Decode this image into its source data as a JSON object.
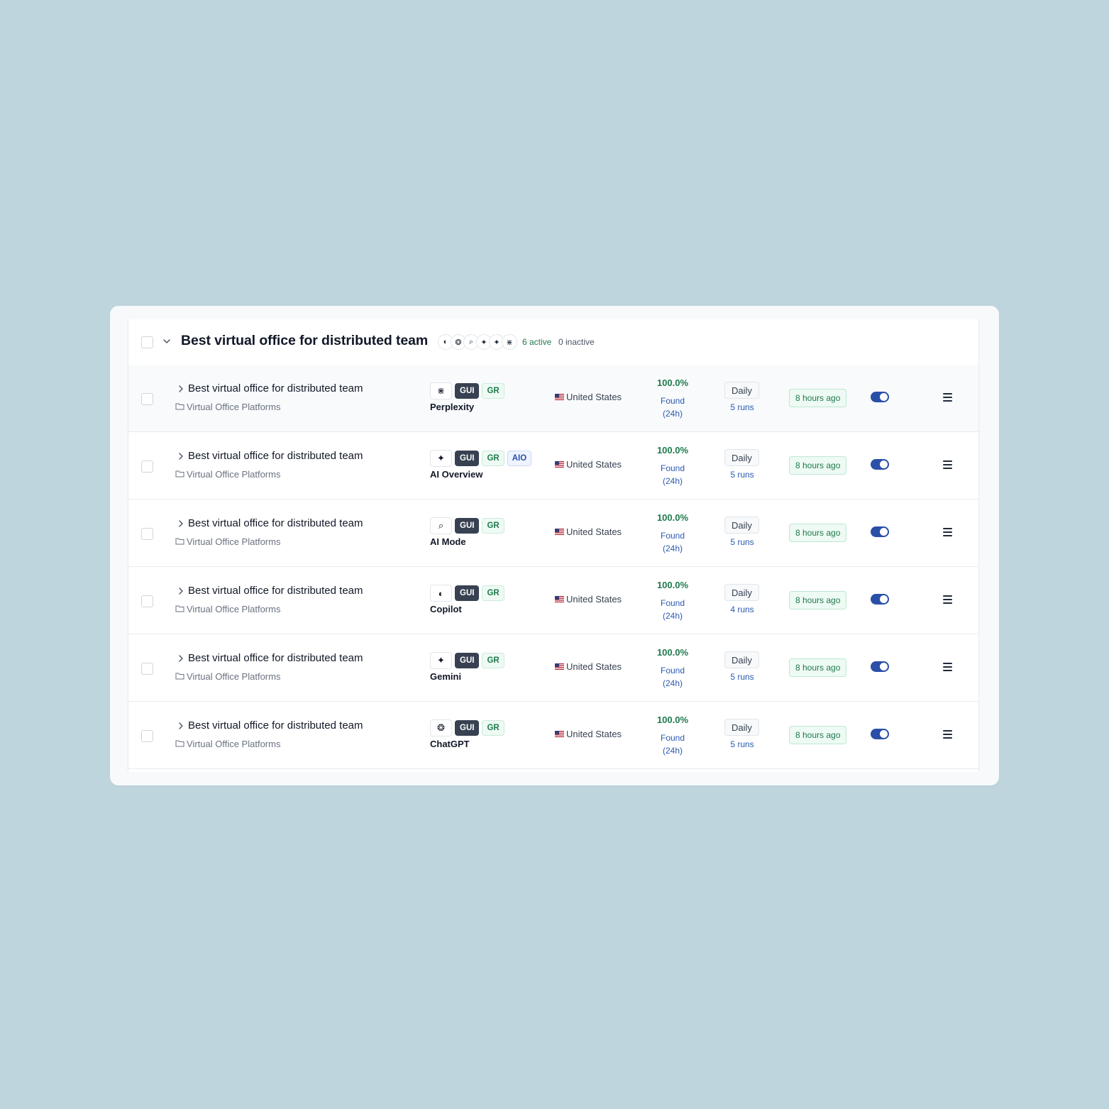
{
  "group": {
    "title": "Best virtual office for distributed team",
    "active_label": "6 active",
    "inactive_label": "0 inactive",
    "engine_icons": [
      "copilot-icon",
      "chatgpt-icon",
      "ai-mode-icon",
      "gemini-icon",
      "ai-overview-icon",
      "perplexity-icon"
    ]
  },
  "colors": {
    "page_bg": "#bfd5dd",
    "accent_green": "#1f7a4d",
    "accent_blue": "#2a4fa8",
    "tag_dark": "#374151"
  },
  "rows": [
    {
      "title": "Best virtual office for distributed team",
      "topic": "Virtual Office Platforms",
      "engine": "Perplexity",
      "engine_icon": "perplexity-icon",
      "engine_glyph": "⋇",
      "tags": [
        "GUI",
        "GR"
      ],
      "country": "United States",
      "found_pct": "100.0%",
      "found_label": "Found",
      "found_window": "(24h)",
      "frequency": "Daily",
      "runs": "5 runs",
      "last_run": "8 hours ago",
      "enabled": true
    },
    {
      "title": "Best virtual office for distributed team",
      "topic": "Virtual Office Platforms",
      "engine": "AI Overview",
      "engine_icon": "ai-overview-icon",
      "engine_glyph": "✦",
      "tags": [
        "GUI",
        "GR",
        "AIO"
      ],
      "country": "United States",
      "found_pct": "100.0%",
      "found_label": "Found",
      "found_window": "(24h)",
      "frequency": "Daily",
      "runs": "5 runs",
      "last_run": "8 hours ago",
      "enabled": true
    },
    {
      "title": "Best virtual office for distributed team",
      "topic": "Virtual Office Platforms",
      "engine": "AI Mode",
      "engine_icon": "ai-mode-icon",
      "engine_glyph": "⌕",
      "tags": [
        "GUI",
        "GR"
      ],
      "country": "United States",
      "found_pct": "100.0%",
      "found_label": "Found",
      "found_window": "(24h)",
      "frequency": "Daily",
      "runs": "5 runs",
      "last_run": "8 hours ago",
      "enabled": true
    },
    {
      "title": "Best virtual office for distributed team",
      "topic": "Virtual Office Platforms",
      "engine": "Copilot",
      "engine_icon": "copilot-icon",
      "engine_glyph": "◐",
      "tags": [
        "GUI",
        "GR"
      ],
      "country": "United States",
      "found_pct": "100.0%",
      "found_label": "Found",
      "found_window": "(24h)",
      "frequency": "Daily",
      "runs": "4 runs",
      "last_run": "8 hours ago",
      "enabled": true
    },
    {
      "title": "Best virtual office for distributed team",
      "topic": "Virtual Office Platforms",
      "engine": "Gemini",
      "engine_icon": "gemini-icon",
      "engine_glyph": "✦",
      "tags": [
        "GUI",
        "GR"
      ],
      "country": "United States",
      "found_pct": "100.0%",
      "found_label": "Found",
      "found_window": "(24h)",
      "frequency": "Daily",
      "runs": "5 runs",
      "last_run": "8 hours ago",
      "enabled": true
    },
    {
      "title": "Best virtual office for distributed team",
      "topic": "Virtual Office Platforms",
      "engine": "ChatGPT",
      "engine_icon": "chatgpt-icon",
      "engine_glyph": "❂",
      "tags": [
        "GUI",
        "GR"
      ],
      "country": "United States",
      "found_pct": "100.0%",
      "found_label": "Found",
      "found_window": "(24h)",
      "frequency": "Daily",
      "runs": "5 runs",
      "last_run": "8 hours ago",
      "enabled": true
    }
  ]
}
